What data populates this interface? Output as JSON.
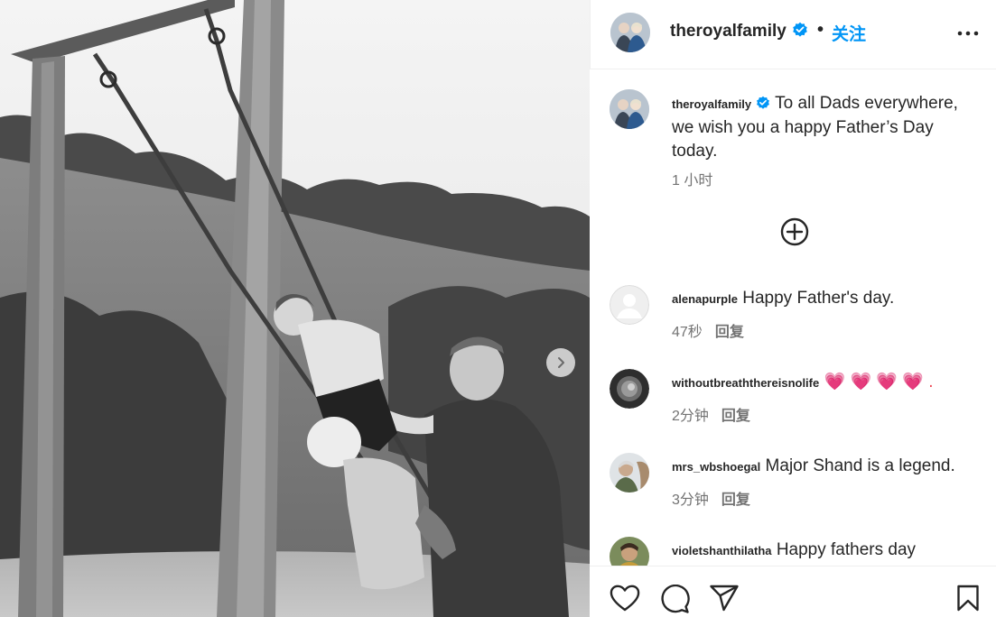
{
  "post": {
    "username": "theroyalfamily",
    "separator": "•",
    "follow_label": "关注",
    "more_icon": "more-horizontal-icon",
    "caption": {
      "username": "theroyalfamily",
      "text": "To all Dads everywhere, we wish you a happy Father’s Day today.",
      "time": "1 小时"
    }
  },
  "comments": [
    {
      "username": "alenapurple",
      "text": "Happy Father's day.",
      "time": "47秒",
      "reply": "回复"
    },
    {
      "username": "withoutbreaththereisnolife",
      "text": "💗 💗 💗 💗 .",
      "time": "2分钟",
      "reply": "回复"
    },
    {
      "username": "mrs_wbshoegal",
      "text": "Major Shand is a legend.",
      "time": "3分钟",
      "reply": "回复"
    },
    {
      "username": "violetshanthilatha",
      "text": "Happy fathers day",
      "time": "",
      "reply": ""
    }
  ],
  "icons": {
    "load_more": "plus-circle-icon",
    "like": "heart-icon",
    "comment": "comment-icon",
    "share": "share-icon",
    "save": "bookmark-icon",
    "next": "chevron-right-icon"
  },
  "colors": {
    "accent": "#0095f6",
    "verified": "#0095f6",
    "muted": "#737373",
    "text": "#262626"
  }
}
